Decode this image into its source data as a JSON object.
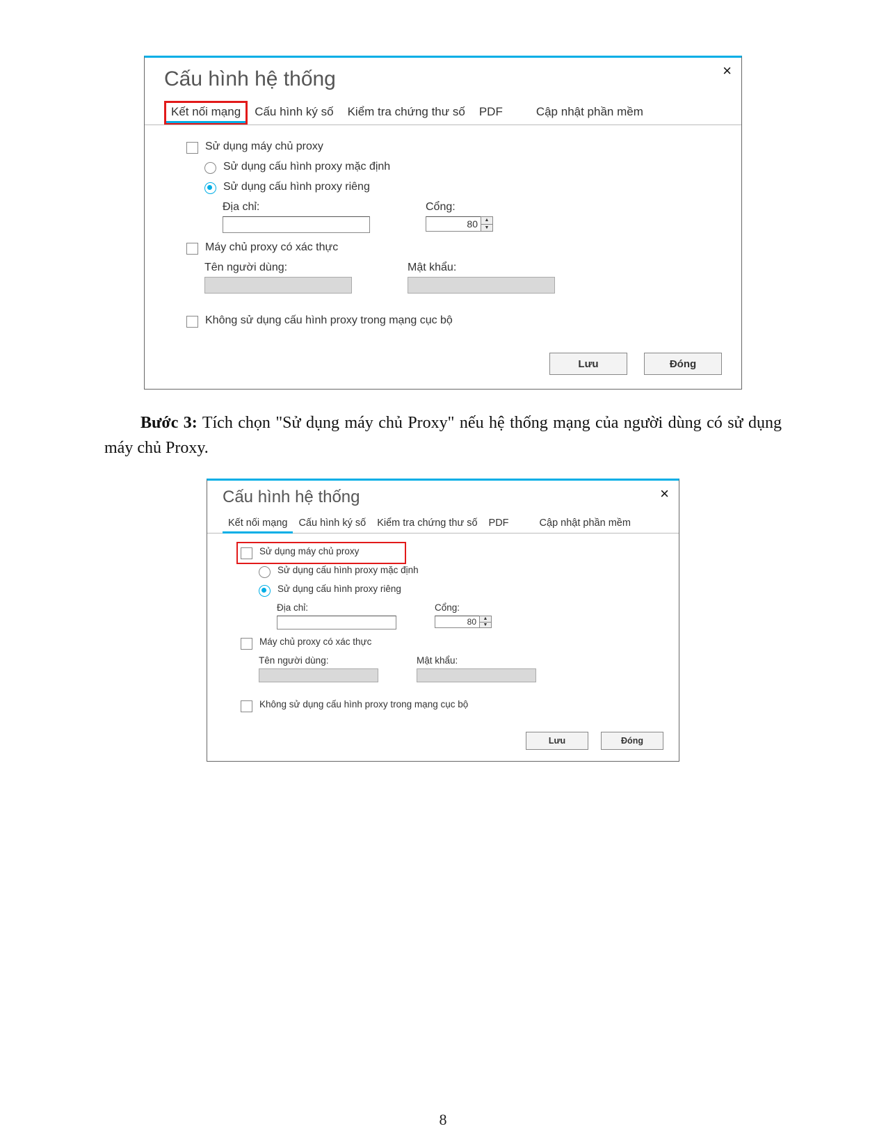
{
  "dialog": {
    "title": "Cấu hình hệ thống",
    "close_symbol": "×",
    "tabs": {
      "network": "Kết nối mạng",
      "signature": "Cấu hình ký số",
      "verify": "Kiểm tra chứng thư số",
      "pdf": "PDF",
      "update": "Cập nhật phần mềm"
    },
    "options": {
      "use_proxy": "Sử dụng máy chủ proxy",
      "default_proxy": "Sử dụng cấu hình proxy mặc định",
      "custom_proxy": "Sử dụng cấu hình proxy riêng",
      "address_label": "Địa chỉ:",
      "port_label": "Cổng:",
      "port_value": "80",
      "auth_proxy": "Máy chủ proxy có xác thực",
      "username_label": "Tên người dùng:",
      "password_label": "Mật khẩu:",
      "no_proxy_local": "Không sử dụng cấu hình proxy trong mạng cục bộ"
    },
    "buttons": {
      "save": "Lưu",
      "close": "Đóng"
    }
  },
  "instruction": {
    "step_label": "Bước 3:",
    "text_after_step": " Tích chọn \"Sử dụng máy chủ Proxy\" nếu hệ thống mạng của người dùng có sử dụng máy chủ Proxy."
  },
  "page_number": "8"
}
